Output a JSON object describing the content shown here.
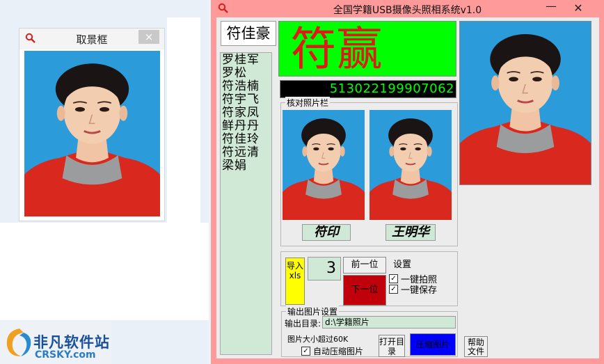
{
  "viewfinder": {
    "title": "取景框",
    "close": "×"
  },
  "logo": {
    "name": "非凡软件站",
    "url": "CRSKY.com"
  },
  "window": {
    "title": "全国学籍USB摄像头照相系统v1.0",
    "minimize": "—",
    "close": "✕"
  },
  "student": {
    "current_name": "符佳豪",
    "big_name": "符赢",
    "id_number": "513022199907062"
  },
  "name_list": [
    "罗桂军",
    "罗松",
    "符浩楠",
    "符宇飞",
    "符家凤",
    "鲜丹丹",
    "符佳玲",
    "符远清",
    "梁娟"
  ],
  "verify": {
    "title": "核对照片栏",
    "signature_1": "符印",
    "signature_2": "王明华"
  },
  "controls": {
    "import_label": "导入xls",
    "number": "3",
    "prev_label": "前一位",
    "next_label": "下一位",
    "settings_label": "设置",
    "one_key_capture": "一键拍照",
    "one_key_save": "一键保存",
    "check_mark": "✓"
  },
  "output": {
    "title": "输出图片设置",
    "dir_label": "输出目录:",
    "dir_value": "d:\\学籍照片",
    "size_label": "图片大小超过60K",
    "auto_compress": "自动压缩图片",
    "open_dir_label": "打开目录",
    "compress_label": "压缩图片",
    "help_label": "帮助文件"
  }
}
